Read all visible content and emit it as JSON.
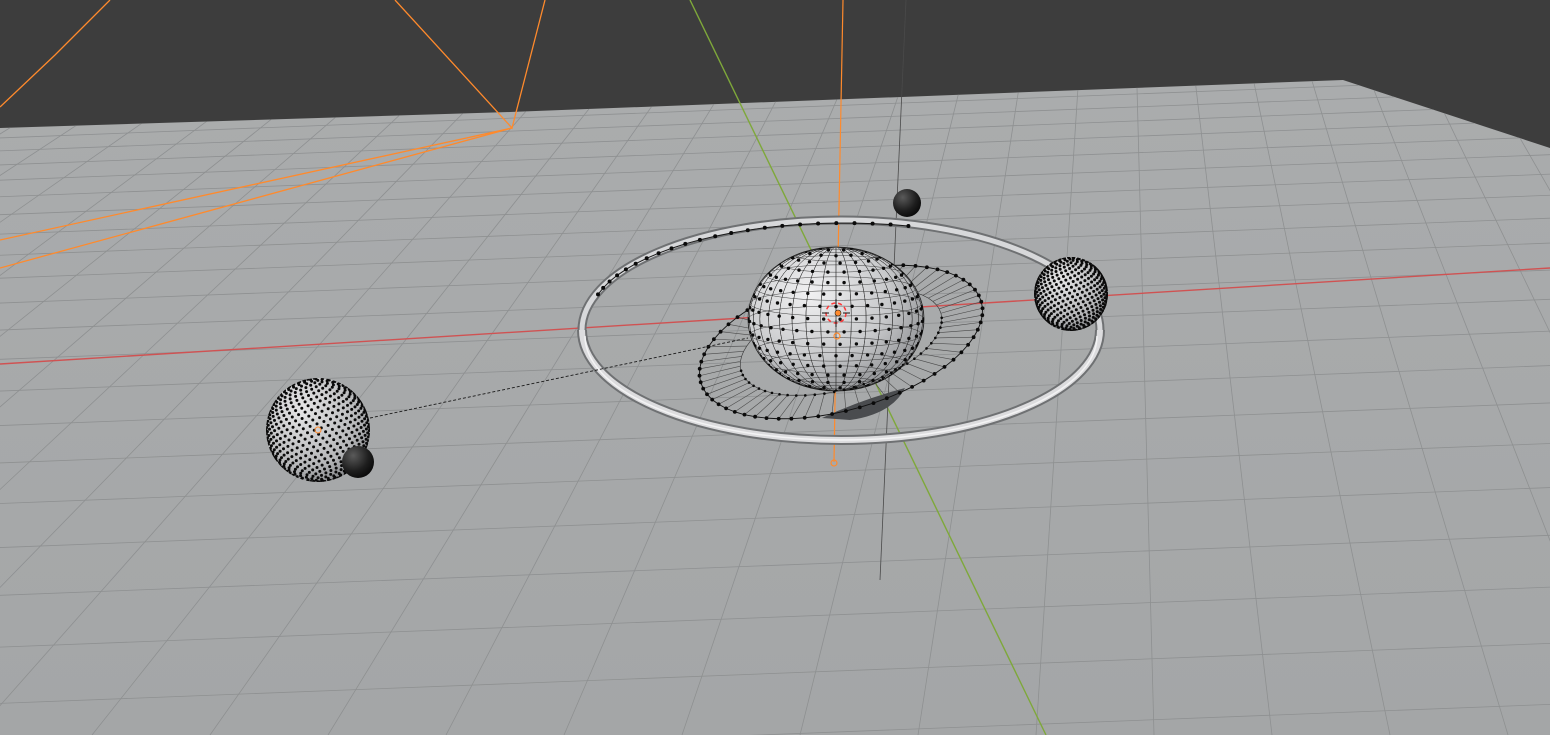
{
  "viewport": {
    "type": "3D Viewport",
    "colors": {
      "background": "#3d3d3d",
      "floor": "#a8aaab",
      "grid_line": "#8e9091",
      "x_axis": "#d05252",
      "y_axis": "#7ea83a",
      "camera_frame": "#ff8a2c",
      "selected_origin": "#ff8a2c",
      "vertex": "#0a0a0a",
      "mesh_fill": "#c9cacc",
      "ring_tube": "#d7d8da"
    },
    "objects": [
      {
        "name": "planet",
        "kind": "uv-sphere-mesh",
        "selected": true,
        "edit_mode": true
      },
      {
        "name": "planet-ring",
        "kind": "ring-mesh",
        "selected": true,
        "edit_mode": true
      },
      {
        "name": "orbit-torus",
        "kind": "torus"
      },
      {
        "name": "orbit-path",
        "kind": "curve-path"
      },
      {
        "name": "moon-left",
        "kind": "icosphere-mesh"
      },
      {
        "name": "moon-right",
        "kind": "icosphere-mesh"
      },
      {
        "name": "small-moon-top",
        "kind": "sphere"
      },
      {
        "name": "small-moon-left",
        "kind": "sphere"
      },
      {
        "name": "camera",
        "kind": "camera",
        "selected": true
      },
      {
        "name": "empty-axis",
        "kind": "empty"
      }
    ]
  }
}
